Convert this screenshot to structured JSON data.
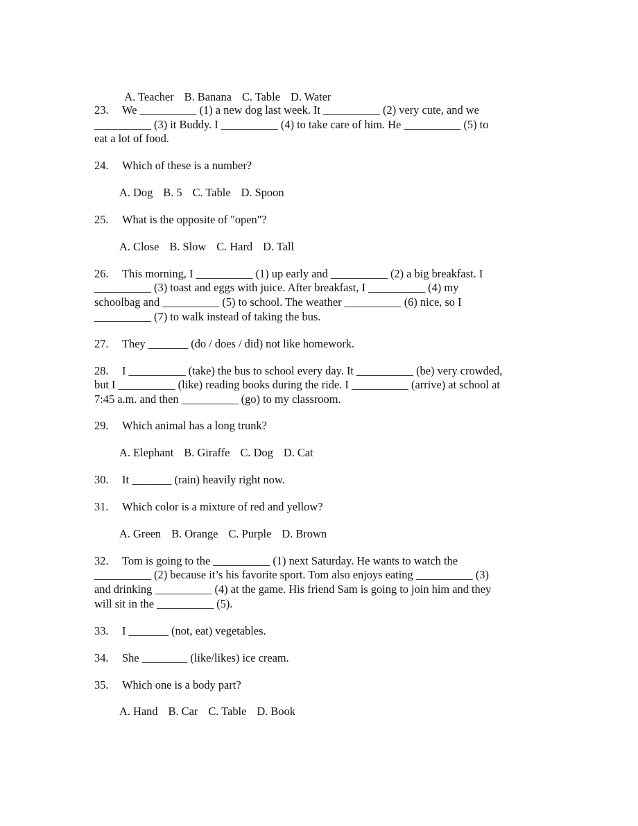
{
  "q22_options": [
    "A. Teacher",
    "B. Banana",
    "C. Table",
    "D. Water"
  ],
  "questions": {
    "q23": {
      "number": "23.",
      "lines": [
        "We __________ (1) a new dog last week. It __________ (2) very cute, and we",
        "__________ (3) it Buddy. I __________ (4) to take care of him. He __________ (5) to",
        "eat a lot of food."
      ]
    },
    "q24": {
      "number": "24.",
      "text": "Which of these is a number?",
      "options": [
        "A. Dog",
        "B. 5",
        "C. Table",
        "D. Spoon"
      ]
    },
    "q25": {
      "number": "25.",
      "text": "What is the opposite of \"open\"?",
      "options": [
        "A. Close",
        "B. Slow",
        "C. Hard",
        "D. Tall"
      ]
    },
    "q26": {
      "number": "26.",
      "lines": [
        "This morning, I __________ (1) up early and __________ (2) a big breakfast. I",
        "__________ (3) toast and eggs with juice. After breakfast, I __________ (4) my",
        "schoolbag and __________ (5) to school. The weather __________ (6) nice, so I",
        "__________ (7) to walk instead of taking the bus."
      ]
    },
    "q27": {
      "number": "27.",
      "text": "They _______ (do / does / did) not like homework."
    },
    "q28": {
      "number": "28.",
      "lines": [
        "I __________ (take) the bus to school every day. It __________ (be) very crowded,",
        "but I __________ (like) reading books during the ride. I __________ (arrive) at school at",
        "7:45 a.m. and then __________ (go) to my classroom."
      ]
    },
    "q29": {
      "number": "29.",
      "text": "Which animal has a long trunk?",
      "options": [
        "A. Elephant",
        "B. Giraffe",
        "C. Dog",
        "D. Cat"
      ]
    },
    "q30": {
      "number": "30.",
      "text": "It _______ (rain) heavily right now."
    },
    "q31": {
      "number": "31.",
      "text": "Which color is a mixture of red and yellow?",
      "options": [
        "A. Green",
        "B. Orange",
        "C. Purple",
        "D. Brown"
      ]
    },
    "q32": {
      "number": "32.",
      "lines": [
        "Tom is going to the __________ (1) next Saturday. He wants to watch the",
        "__________ (2) because it’s his favorite sport. Tom also enjoys eating __________ (3)",
        "and drinking __________ (4) at the game. His friend Sam is going to join him and they",
        "will sit in the __________ (5)."
      ]
    },
    "q33": {
      "number": "33.",
      "text": "I _______ (not, eat) vegetables."
    },
    "q34": {
      "number": "34.",
      "text": "She ________ (like/likes) ice cream."
    },
    "q35": {
      "number": "35.",
      "text": "Which one is a body part?",
      "options": [
        "A. Hand",
        "B. Car",
        "C. Table",
        "D. Book"
      ]
    }
  }
}
